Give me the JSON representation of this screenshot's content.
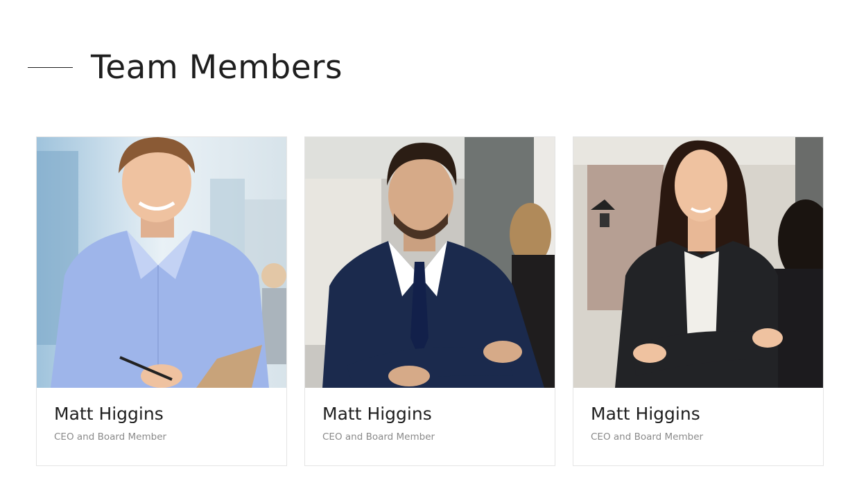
{
  "section": {
    "title": "Team Members"
  },
  "members": [
    {
      "name": "Matt Higgins",
      "role": "CEO and Board Member",
      "photo_icon": "portrait-photo"
    },
    {
      "name": "Matt Higgins",
      "role": "CEO and Board Member",
      "photo_icon": "portrait-photo"
    },
    {
      "name": "Matt Higgins",
      "role": "CEO and Board Member",
      "photo_icon": "portrait-photo"
    }
  ],
  "colors": {
    "text": "#1e1e1e",
    "muted": "#8a8a8a",
    "card_border": "#e4e4e4",
    "background": "#ffffff"
  }
}
